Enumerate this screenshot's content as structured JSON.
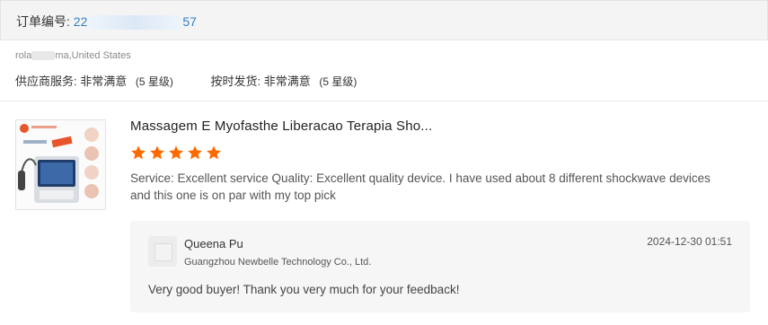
{
  "order": {
    "label": "订单编号:",
    "number_prefix": "22",
    "number_suffix": "57"
  },
  "buyer": {
    "region_prefix": "rola",
    "region_suffix": "ma,United States"
  },
  "ratings": [
    {
      "label": "供应商服务:",
      "value": "非常满意",
      "level": "(5 星级)"
    },
    {
      "label": "按时发货:",
      "value": "非常满意",
      "level": "(5 星级)"
    }
  ],
  "product": {
    "title": "Massagem E Myofasthe Liberacao Terapia Sho...",
    "image_icon": "product-device-image",
    "rating_stars": 5,
    "star_color": "#ff6a00"
  },
  "review": {
    "text": "Service:   Excellent service  Quality:   Excellent quality device. I have used about 8 different shockwave  devices and this one is on par with my top pick"
  },
  "reply": {
    "name": "Queena Pu",
    "company": "Guangzhou Newbelle Technology Co., Ltd.",
    "time": "2024-12-30 01:51",
    "message": "Very good buyer! Thank you very much for your feedback!"
  },
  "colors": {
    "link": "#2f7fcf",
    "accent": "#ff6a00"
  }
}
